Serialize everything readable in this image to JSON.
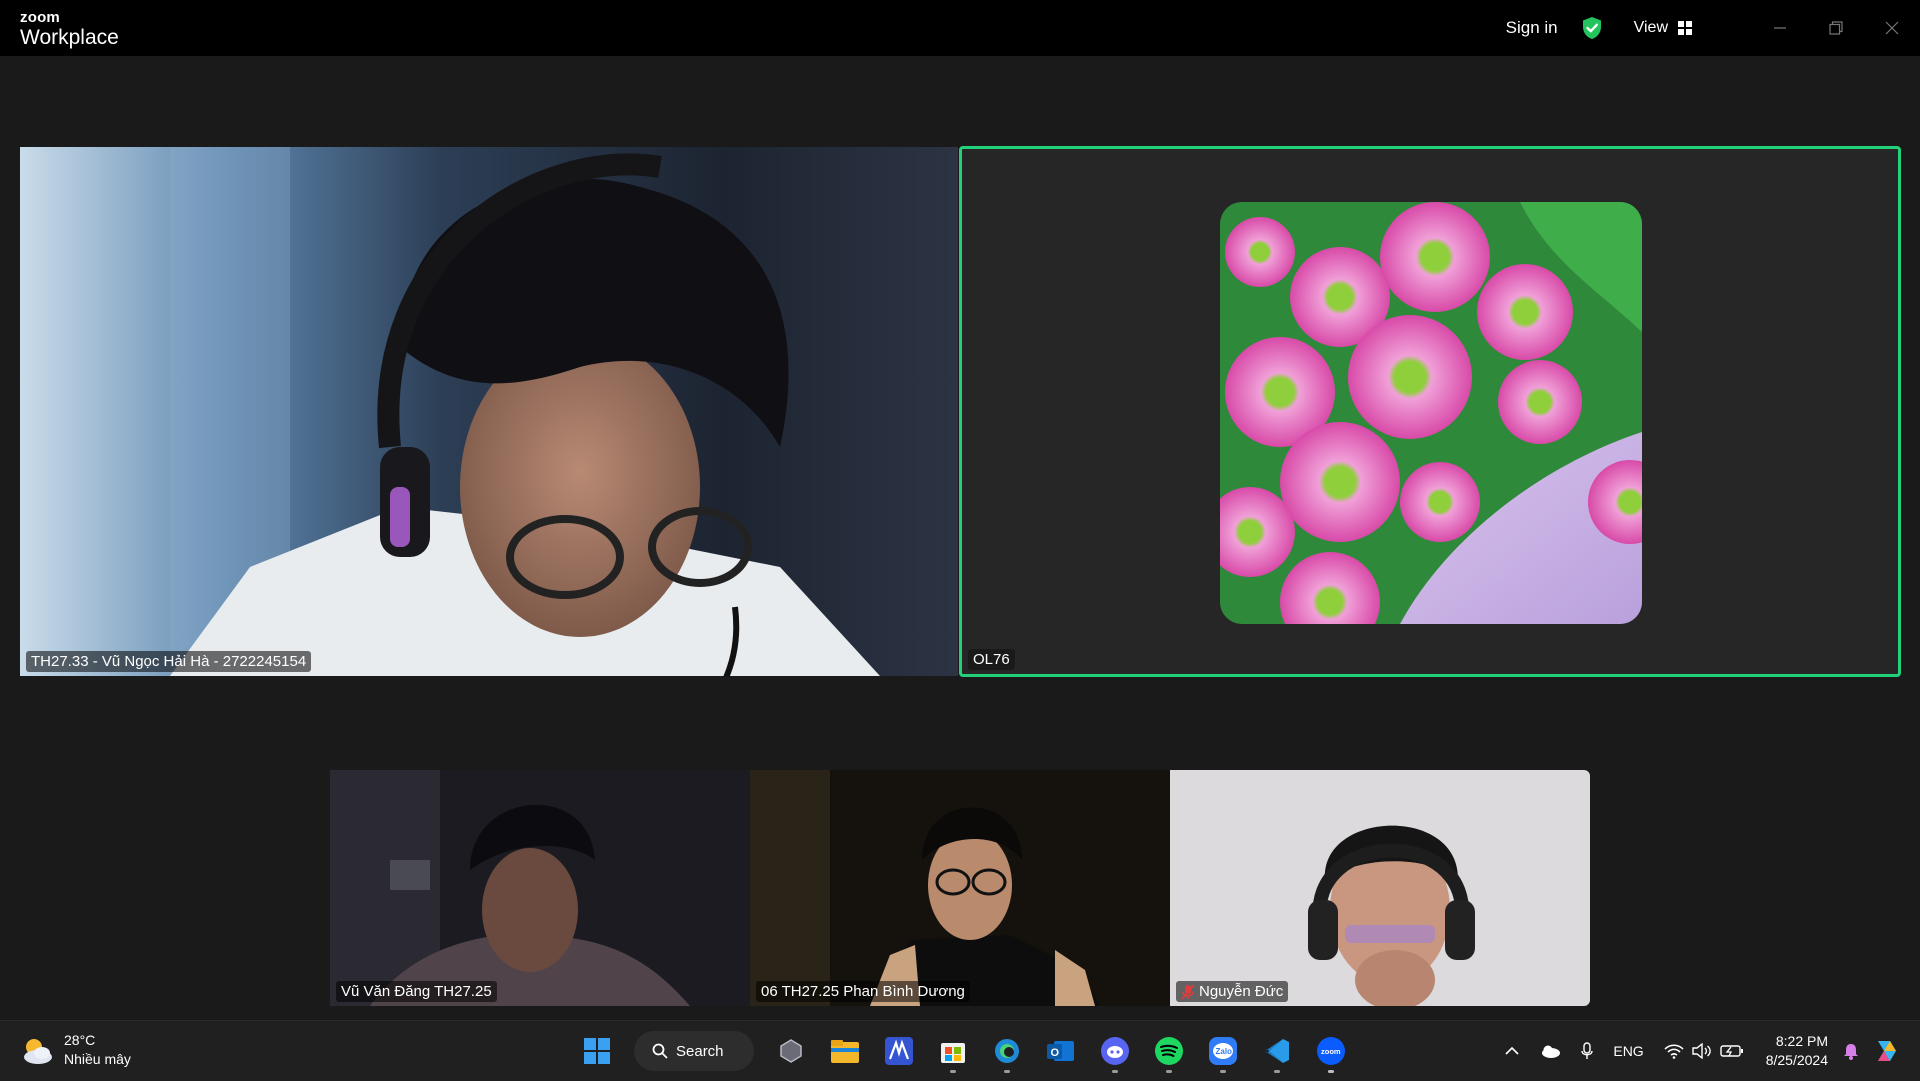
{
  "titlebar": {
    "logo_top": "zoom",
    "logo_bottom": "Workplace",
    "sign_in": "Sign in",
    "view": "View"
  },
  "participants": {
    "main_left": "TH27.33 - Vũ Ngọc Hải Hà - 2722245154",
    "main_right": "OL76",
    "bottom_1": "Vũ Văn Đăng TH27.25",
    "bottom_2": "06 TH27.25 Phan Bình Dương",
    "bottom_3": "Nguyễn Đức"
  },
  "colors": {
    "active_speaker": "#23d17a",
    "muted": "#e23b3b"
  },
  "taskbar": {
    "temperature": "28°C",
    "weather": "Nhiều mây",
    "search": "Search",
    "language": "ENG",
    "time": "8:22 PM",
    "date": "8/25/2024",
    "apps": [
      "windows-start-icon",
      "search",
      "task-view-icon",
      "file-explorer-icon",
      "mural-icon",
      "microsoft-store-icon",
      "edge-icon",
      "outlook-icon",
      "discord-icon",
      "spotify-icon",
      "zalo-icon",
      "vscode-icon",
      "zoom-icon"
    ]
  }
}
